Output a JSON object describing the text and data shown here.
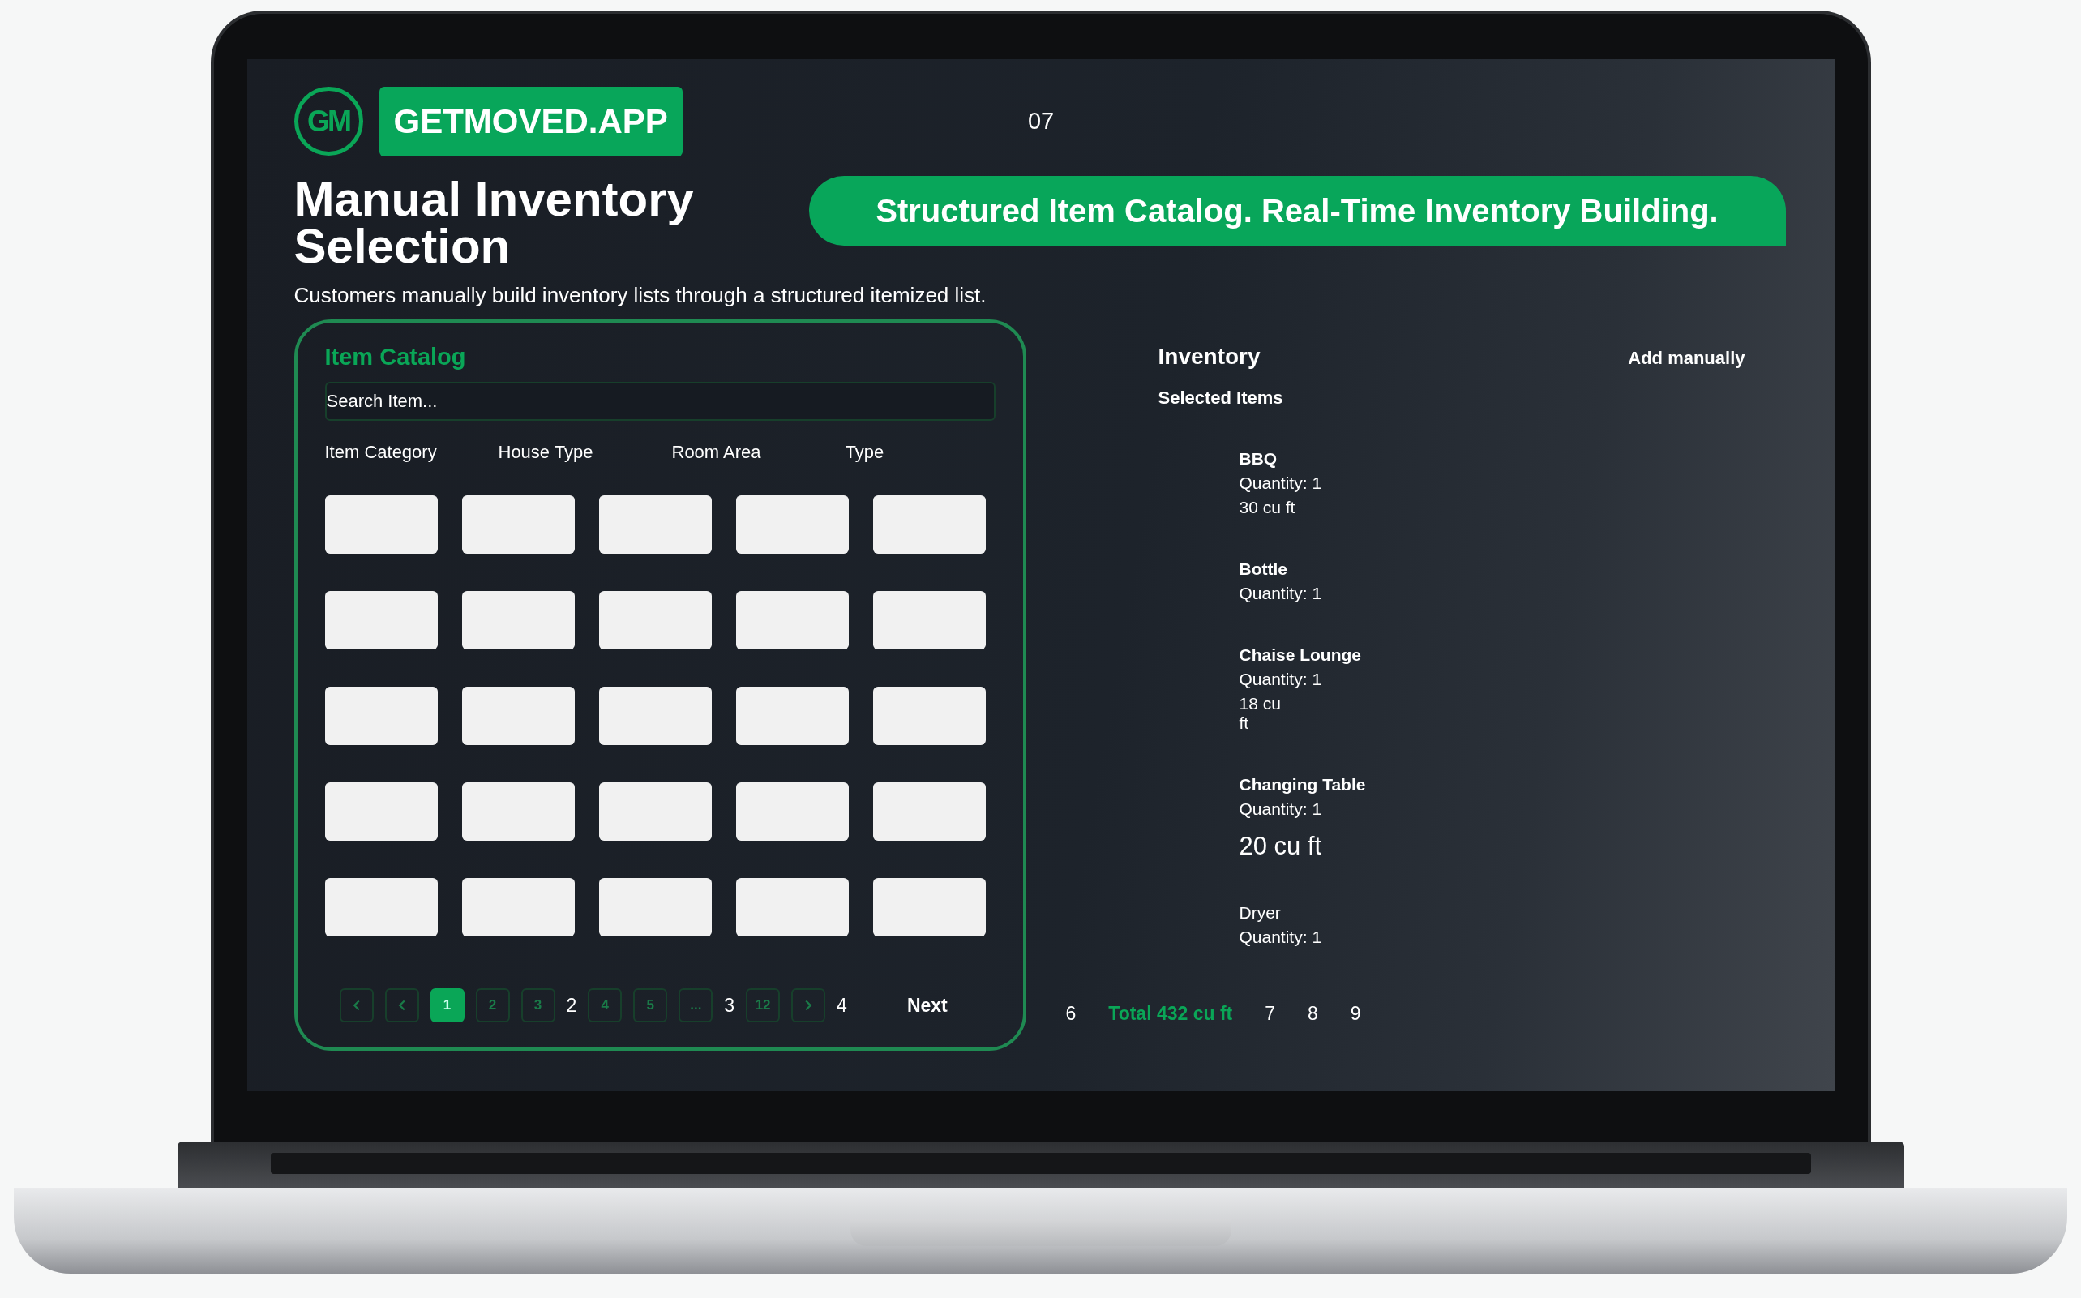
{
  "header": {
    "logo": "GM",
    "brand": "GETMOVED.APP",
    "slide_number": "07"
  },
  "title": "Manual Inventory Selection",
  "tagline": "Structured Item Catalog. Real-Time Inventory Building.",
  "subtitle": "Customers manually build inventory lists through a structured itemized list.",
  "catalog": {
    "title": "Item Catalog",
    "search": {
      "placeholder": "Search Item..."
    },
    "filters": [
      "Item Category",
      "House Type",
      "Room Area",
      "Type"
    ],
    "pagination": [
      {
        "kind": "first"
      },
      {
        "kind": "prev"
      },
      {
        "kind": "page",
        "label": "1",
        "selected": true
      },
      {
        "kind": "page",
        "label": "2",
        "selected": false
      },
      {
        "kind": "page",
        "label": "3",
        "selected": false
      },
      {
        "kind": "marker",
        "label": "2"
      },
      {
        "kind": "page",
        "label": "4",
        "selected": false
      },
      {
        "kind": "page",
        "label": "5",
        "selected": false
      },
      {
        "kind": "page",
        "label": "...",
        "selected": false
      },
      {
        "kind": "marker",
        "label": "3"
      },
      {
        "kind": "page",
        "label": "12",
        "selected": false
      },
      {
        "kind": "next"
      },
      {
        "kind": "marker",
        "label": "4"
      },
      {
        "kind": "link",
        "label": "Next"
      }
    ]
  },
  "inventory": {
    "title": "Inventory",
    "action": "Add manually",
    "subtitle": "Selected Items",
    "items": [
      {
        "name": "BBQ",
        "strong": true,
        "lines": [
          {
            "text": "Quantity: 1",
            "kind": "normal"
          },
          {
            "text": "30 cu ft",
            "kind": "normal"
          }
        ]
      },
      {
        "name": "Bottle",
        "strong": true,
        "lines": [
          {
            "text": "Quantity: 1",
            "kind": "normal"
          }
        ]
      },
      {
        "name": "Chaise Lounge",
        "strong": true,
        "lines": [
          {
            "text": "Quantity: 1",
            "kind": "normal"
          },
          {
            "text": "18 cu ft",
            "kind": "narrow"
          }
        ]
      },
      {
        "name": "Changing Table",
        "strong": true,
        "lines": [
          {
            "text": "Quantity: 1",
            "kind": "normal"
          },
          {
            "text": "20 cu ft",
            "kind": "large"
          }
        ]
      },
      {
        "name": "Dryer",
        "strong": false,
        "lines": [
          {
            "text": "Quantity: 1",
            "kind": "normal"
          }
        ]
      }
    ]
  },
  "footer": [
    {
      "kind": "marker",
      "label": "6"
    },
    {
      "kind": "total",
      "label": "Total 432 cu ft"
    },
    {
      "kind": "marker",
      "label": "7"
    },
    {
      "kind": "marker",
      "label": "8"
    },
    {
      "kind": "marker",
      "label": "9"
    }
  ]
}
